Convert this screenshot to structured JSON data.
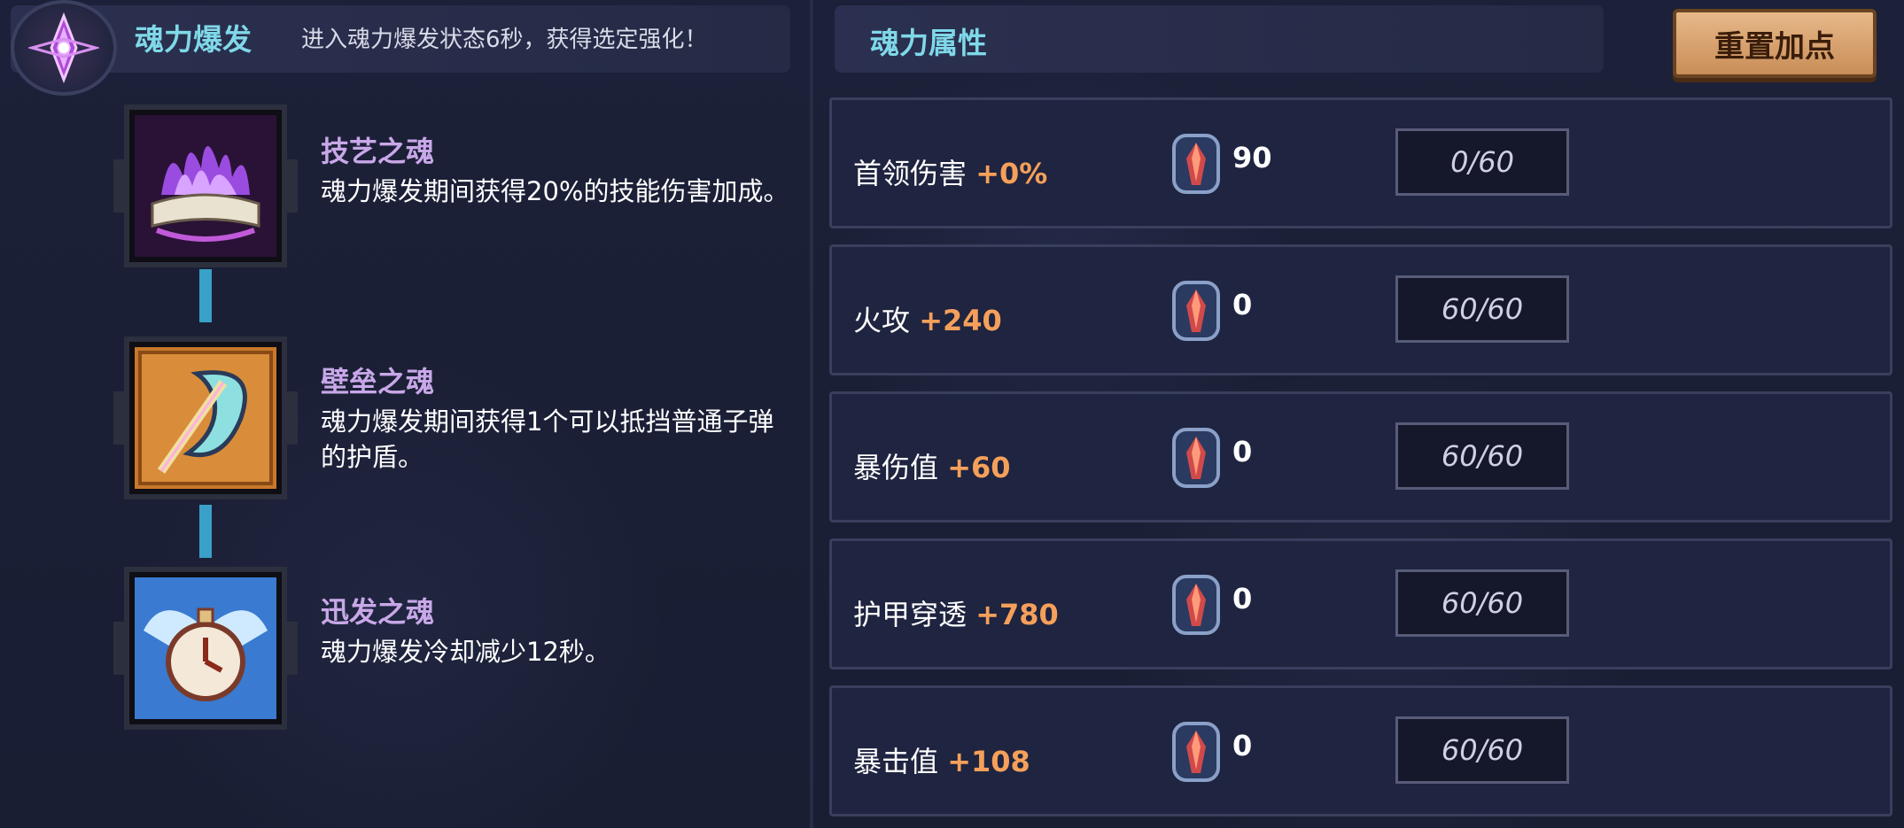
{
  "soul_burst": {
    "title": "魂力爆发",
    "description": "进入魂力爆发状态6秒，获得选定强化！",
    "emblem_icon": "purple-crystal-icon"
  },
  "skills": [
    {
      "name": "技艺之魂",
      "description": "魂力爆发期间获得20%的技能伤害加成。",
      "icon": "purple-flame-book-icon"
    },
    {
      "name": "壁垒之魂",
      "description": "魂力爆发期间获得1个可以抵挡普通子弹的护盾。",
      "icon": "golden-shield-icon"
    },
    {
      "name": "迅发之魂",
      "description": "魂力爆发冷却减少12秒。",
      "icon": "winged-clock-icon"
    }
  ],
  "soul_attributes": {
    "title": "魂力属性",
    "reset_label": "重置加点",
    "rows": [
      {
        "label": "首领伤害",
        "bonus": "+0%",
        "cost": "90",
        "progress": "0/60"
      },
      {
        "label": "火攻",
        "bonus": "+240",
        "cost": "0",
        "progress": "60/60"
      },
      {
        "label": "暴伤值",
        "bonus": "+60",
        "cost": "0",
        "progress": "60/60"
      },
      {
        "label": "护甲穿透",
        "bonus": "+780",
        "cost": "0",
        "progress": "60/60"
      },
      {
        "label": "暴击值",
        "bonus": "+108",
        "cost": "0",
        "progress": "60/60"
      }
    ],
    "cost_icon": "soul-gem-icon"
  },
  "colors": {
    "accent_cyan": "#7fd8e8",
    "bonus_orange": "#f5a05a",
    "skill_name_purple": "#c8a8e8",
    "button_tan": "#d9a06c"
  }
}
